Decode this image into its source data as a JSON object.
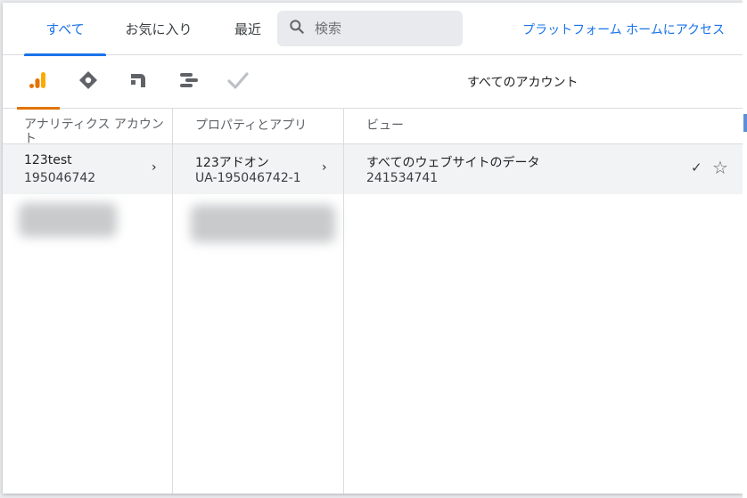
{
  "tabs": [
    {
      "label": "すべて",
      "active": true
    },
    {
      "label": "お気に入り",
      "active": false
    },
    {
      "label": "最近",
      "active": false
    }
  ],
  "search": {
    "placeholder": "検索",
    "value": ""
  },
  "platform_link": "プラットフォーム ホームにアクセス",
  "products": [
    {
      "icon": "analytics-icon",
      "active": true,
      "color": "#f9ab00"
    },
    {
      "icon": "tag-manager-icon",
      "active": false,
      "color": "#5f6368"
    },
    {
      "icon": "optimize-icon",
      "active": false,
      "color": "#5f6368"
    },
    {
      "icon": "data-studio-icon",
      "active": false,
      "color": "#5f6368"
    },
    {
      "icon": "surveys-check-icon",
      "active": false,
      "color": "#bdc1c6"
    }
  ],
  "all_accounts_label": "すべてのアカウント",
  "columns": {
    "account": {
      "header": "アナリティクス アカウント",
      "name": "123test",
      "id": "195046742"
    },
    "property": {
      "header": "プロパティとアプリ",
      "name": "123アドオン",
      "id": "UA-195046742-1"
    },
    "view": {
      "header": "ビュー",
      "name": "すべてのウェブサイトのデータ",
      "id": "241534741"
    }
  },
  "colors": {
    "accent": "#1a73e8",
    "analytics_orange": "#e37400",
    "selected_row": "#f1f3f4"
  }
}
